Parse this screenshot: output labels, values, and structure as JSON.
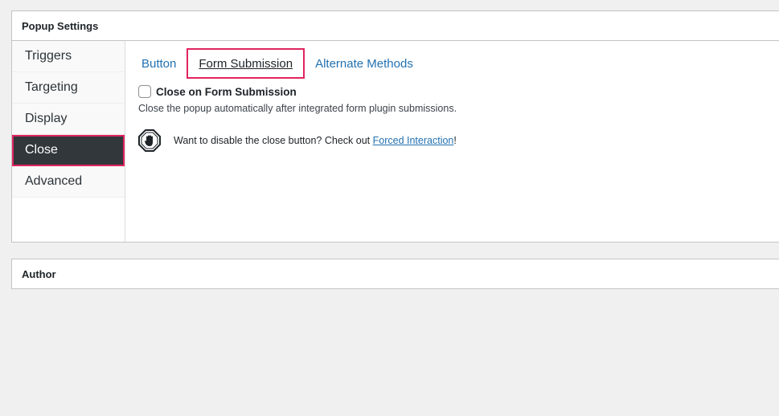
{
  "settings": {
    "title": "Popup Settings",
    "sidebar": {
      "items": [
        {
          "label": "Triggers"
        },
        {
          "label": "Targeting"
        },
        {
          "label": "Display"
        },
        {
          "label": "Close",
          "active": true
        },
        {
          "label": "Advanced"
        }
      ]
    },
    "tabs": [
      {
        "label": "Button"
      },
      {
        "label": "Form Submission",
        "active": true
      },
      {
        "label": "Alternate Methods"
      }
    ],
    "field": {
      "label": "Close on Form Submission",
      "checked": false,
      "description": "Close the popup automatically after integrated form plugin submissions."
    },
    "notice": {
      "icon": "stop-hand-icon",
      "text": "Want to disable the close button? Check out ",
      "link": "Forced Interaction",
      "suffix": "!"
    }
  },
  "author": {
    "title": "Author"
  },
  "colors": {
    "accent": "#e0245e",
    "link": "#2271b1",
    "active_bg": "#32373c"
  }
}
